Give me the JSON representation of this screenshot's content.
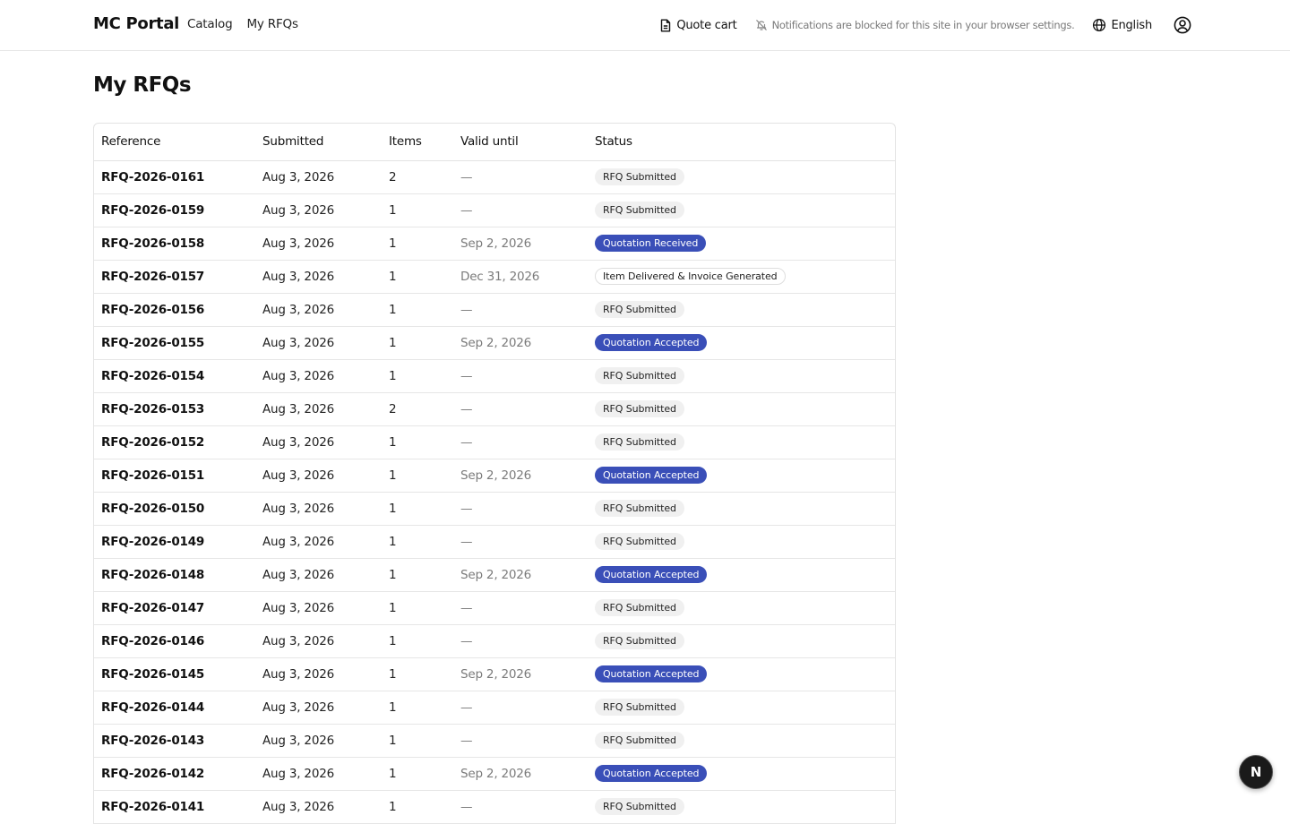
{
  "header": {
    "brand": "MC Portal",
    "nav": [
      {
        "label": "Catalog"
      },
      {
        "label": "My RFQs"
      }
    ],
    "quote_cart_label": "Quote cart",
    "notification_notice": "Notifications are blocked for this site in your browser settings.",
    "language_label": "English"
  },
  "page": {
    "title": "My RFQs"
  },
  "table": {
    "columns": [
      "Reference",
      "Submitted",
      "Items",
      "Valid until",
      "Status"
    ],
    "rows": [
      {
        "ref": "RFQ-2026-0161",
        "submitted": "Aug 3, 2026",
        "items": "2",
        "valid": "—",
        "status": "RFQ Submitted",
        "kind": "submitted"
      },
      {
        "ref": "RFQ-2026-0159",
        "submitted": "Aug 3, 2026",
        "items": "1",
        "valid": "—",
        "status": "RFQ Submitted",
        "kind": "submitted"
      },
      {
        "ref": "RFQ-2026-0158",
        "submitted": "Aug 3, 2026",
        "items": "1",
        "valid": "Sep 2, 2026",
        "status": "Quotation Received",
        "kind": "received"
      },
      {
        "ref": "RFQ-2026-0157",
        "submitted": "Aug 3, 2026",
        "items": "1",
        "valid": "Dec 31, 2026",
        "status": "Item Delivered & Invoice Generated",
        "kind": "delivered"
      },
      {
        "ref": "RFQ-2026-0156",
        "submitted": "Aug 3, 2026",
        "items": "1",
        "valid": "—",
        "status": "RFQ Submitted",
        "kind": "submitted"
      },
      {
        "ref": "RFQ-2026-0155",
        "submitted": "Aug 3, 2026",
        "items": "1",
        "valid": "Sep 2, 2026",
        "status": "Quotation Accepted",
        "kind": "accepted"
      },
      {
        "ref": "RFQ-2026-0154",
        "submitted": "Aug 3, 2026",
        "items": "1",
        "valid": "—",
        "status": "RFQ Submitted",
        "kind": "submitted"
      },
      {
        "ref": "RFQ-2026-0153",
        "submitted": "Aug 3, 2026",
        "items": "2",
        "valid": "—",
        "status": "RFQ Submitted",
        "kind": "submitted"
      },
      {
        "ref": "RFQ-2026-0152",
        "submitted": "Aug 3, 2026",
        "items": "1",
        "valid": "—",
        "status": "RFQ Submitted",
        "kind": "submitted"
      },
      {
        "ref": "RFQ-2026-0151",
        "submitted": "Aug 3, 2026",
        "items": "1",
        "valid": "Sep 2, 2026",
        "status": "Quotation Accepted",
        "kind": "accepted"
      },
      {
        "ref": "RFQ-2026-0150",
        "submitted": "Aug 3, 2026",
        "items": "1",
        "valid": "—",
        "status": "RFQ Submitted",
        "kind": "submitted"
      },
      {
        "ref": "RFQ-2026-0149",
        "submitted": "Aug 3, 2026",
        "items": "1",
        "valid": "—",
        "status": "RFQ Submitted",
        "kind": "submitted"
      },
      {
        "ref": "RFQ-2026-0148",
        "submitted": "Aug 3, 2026",
        "items": "1",
        "valid": "Sep 2, 2026",
        "status": "Quotation Accepted",
        "kind": "accepted"
      },
      {
        "ref": "RFQ-2026-0147",
        "submitted": "Aug 3, 2026",
        "items": "1",
        "valid": "—",
        "status": "RFQ Submitted",
        "kind": "submitted"
      },
      {
        "ref": "RFQ-2026-0146",
        "submitted": "Aug 3, 2026",
        "items": "1",
        "valid": "—",
        "status": "RFQ Submitted",
        "kind": "submitted"
      },
      {
        "ref": "RFQ-2026-0145",
        "submitted": "Aug 3, 2026",
        "items": "1",
        "valid": "Sep 2, 2026",
        "status": "Quotation Accepted",
        "kind": "accepted"
      },
      {
        "ref": "RFQ-2026-0144",
        "submitted": "Aug 3, 2026",
        "items": "1",
        "valid": "—",
        "status": "RFQ Submitted",
        "kind": "submitted"
      },
      {
        "ref": "RFQ-2026-0143",
        "submitted": "Aug 3, 2026",
        "items": "1",
        "valid": "—",
        "status": "RFQ Submitted",
        "kind": "submitted"
      },
      {
        "ref": "RFQ-2026-0142",
        "submitted": "Aug 3, 2026",
        "items": "1",
        "valid": "Sep 2, 2026",
        "status": "Quotation Accepted",
        "kind": "accepted"
      },
      {
        "ref": "RFQ-2026-0141",
        "submitted": "Aug 3, 2026",
        "items": "1",
        "valid": "—",
        "status": "RFQ Submitted",
        "kind": "submitted"
      }
    ]
  },
  "fab": {
    "label": "N"
  },
  "colors": {
    "accent_badge": "#3a4fb8",
    "muted_badge": "#f0f0f0",
    "border": "#e3e3e3"
  },
  "icons": {
    "quote_cart": "document-icon",
    "notification": "bell-off-icon",
    "language": "globe-icon",
    "account": "user-circle-icon"
  }
}
